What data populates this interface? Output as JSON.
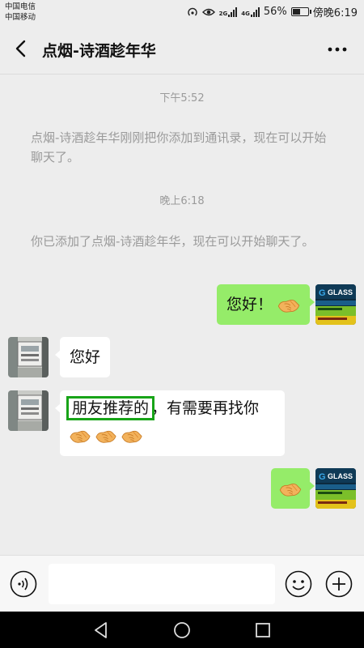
{
  "status_bar": {
    "carrier_1": "中国电信",
    "carrier_2": "中国移动",
    "net_1": "2G",
    "net_2": "4G",
    "battery_text": "56%",
    "battery_level": 0.56,
    "time": "傍晚6:19"
  },
  "header": {
    "title": "点烟-诗酒趁年华",
    "back_icon": "chevron-left-icon",
    "more_icon": "more-dots-icon"
  },
  "chat": {
    "time_1": "下午5:52",
    "system_1": "点烟-诗酒趁年华刚刚把你添加到通讯录，现在可以开始聊天了。",
    "time_2": "晚上6:18",
    "system_2": "你已添加了点烟-诗酒趁年华，现在可以开始聊天了。",
    "messages": [
      {
        "from": "me",
        "text": "您好！",
        "emoji": "handshake"
      },
      {
        "from": "them",
        "text": "您好"
      },
      {
        "from": "them",
        "highlight": "朋友推荐的",
        "text": "，有需要再找你",
        "emoji_count": 3
      },
      {
        "from": "me",
        "emoji": "handshake"
      }
    ]
  },
  "input_bar": {
    "voice_icon": "voice-icon",
    "placeholder": "",
    "emoji_icon": "smiley-icon",
    "plus_icon": "plus-icon"
  },
  "my_avatar": {
    "brand_text": "GLASS"
  },
  "colors": {
    "bubble_me": "#95ec69",
    "bubble_them": "#ffffff",
    "highlight_box": "#18a418",
    "background": "#ededed"
  }
}
